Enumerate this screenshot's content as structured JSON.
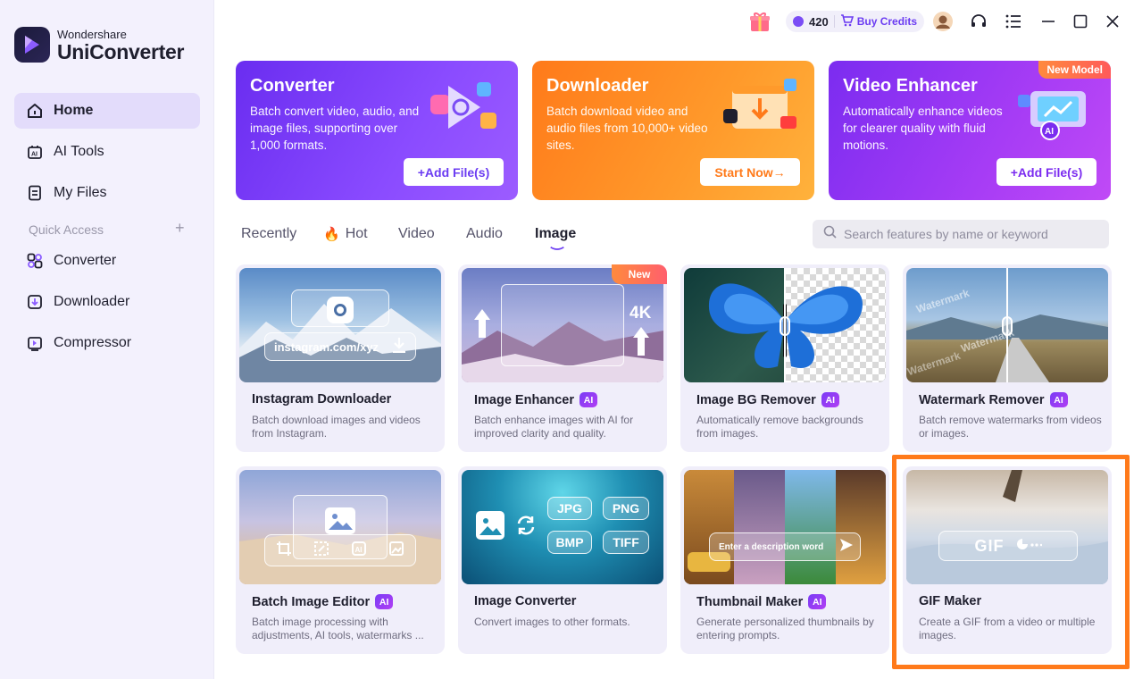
{
  "app": {
    "brand_sub": "Wondershare",
    "brand_main": "UniConverter"
  },
  "topbar": {
    "credits": "420",
    "buy_label": "Buy Credits"
  },
  "sidebar": {
    "items": [
      {
        "label": "Home"
      },
      {
        "label": "AI Tools"
      },
      {
        "label": "My Files"
      }
    ],
    "quick_access_label": "Quick Access",
    "quick_items": [
      {
        "label": "Converter"
      },
      {
        "label": "Downloader"
      },
      {
        "label": "Compressor"
      }
    ]
  },
  "features": [
    {
      "title": "Converter",
      "desc": "Batch convert video, audio, and image files, supporting over 1,000 formats.",
      "button": "+Add File(s)"
    },
    {
      "title": "Downloader",
      "desc": "Batch download video and audio files from 10,000+ video sites.",
      "button": "Start Now→"
    },
    {
      "title": "Video Enhancer",
      "desc": "Automatically enhance videos for clearer quality with fluid motions.",
      "button": "+Add File(s)",
      "badge": "New Model"
    }
  ],
  "tabs": [
    "Recently",
    "Hot",
    "Video",
    "Audio",
    "Image"
  ],
  "active_tab": "Image",
  "search": {
    "placeholder": "Search features by name or keyword"
  },
  "tools": [
    {
      "title": "Instagram Downloader",
      "ai": false,
      "desc": "Batch download images and videos from Instagram.",
      "thumb_text": "instagram.com/xyz"
    },
    {
      "title": "Image Enhancer",
      "ai": true,
      "desc": "Batch enhance images with AI for improved clarity and quality.",
      "badge": "New",
      "thumb_text": "4K"
    },
    {
      "title": "Image BG Remover",
      "ai": true,
      "desc": "Automatically remove backgrounds from images."
    },
    {
      "title": "Watermark Remover",
      "ai": true,
      "desc": "Batch remove watermarks from videos or images.",
      "thumb_text": "Watermark"
    },
    {
      "title": "Batch Image Editor",
      "ai": true,
      "desc": "Batch image processing with adjustments, AI tools, watermarks ..."
    },
    {
      "title": "Image Converter",
      "ai": false,
      "desc": "Convert images to other formats.",
      "formats": [
        "JPG",
        "PNG",
        "BMP",
        "TIFF"
      ]
    },
    {
      "title": "Thumbnail Maker",
      "ai": true,
      "desc": "Generate personalized thumbnails by entering prompts.",
      "thumb_text": "Enter a description word"
    },
    {
      "title": "GIF Maker",
      "ai": false,
      "desc": "Create a GIF from a video or multiple images.",
      "thumb_text": "GIF"
    }
  ],
  "ai_label": "AI",
  "colors": {
    "accent": "#6b3cf2",
    "orange": "#ff7a1a",
    "sidebar_bg": "#f3f1fd",
    "card_bg": "#f0eefa"
  }
}
